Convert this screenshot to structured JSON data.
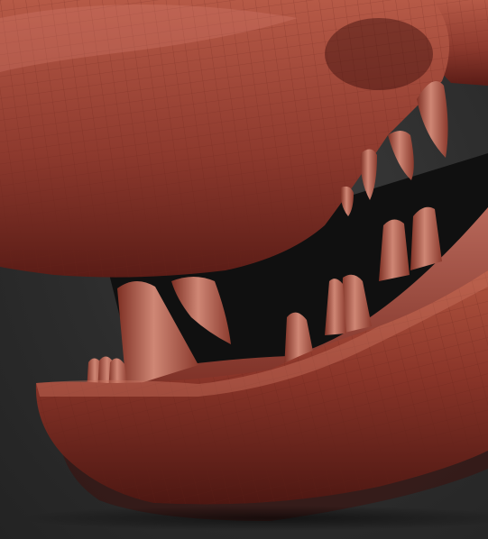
{
  "scene": {
    "subject": "sculpted-creature-jaw",
    "colors": {
      "background": "#2b2b2b",
      "clay_base": "#8e3a2e",
      "clay_light": "#b85a48",
      "clay_dark": "#4a1612",
      "tooth_base": "#a9584a",
      "tooth_light": "#d08a78",
      "mouth_interior": "#0f0f0f",
      "wire": "#6f2a21"
    }
  }
}
